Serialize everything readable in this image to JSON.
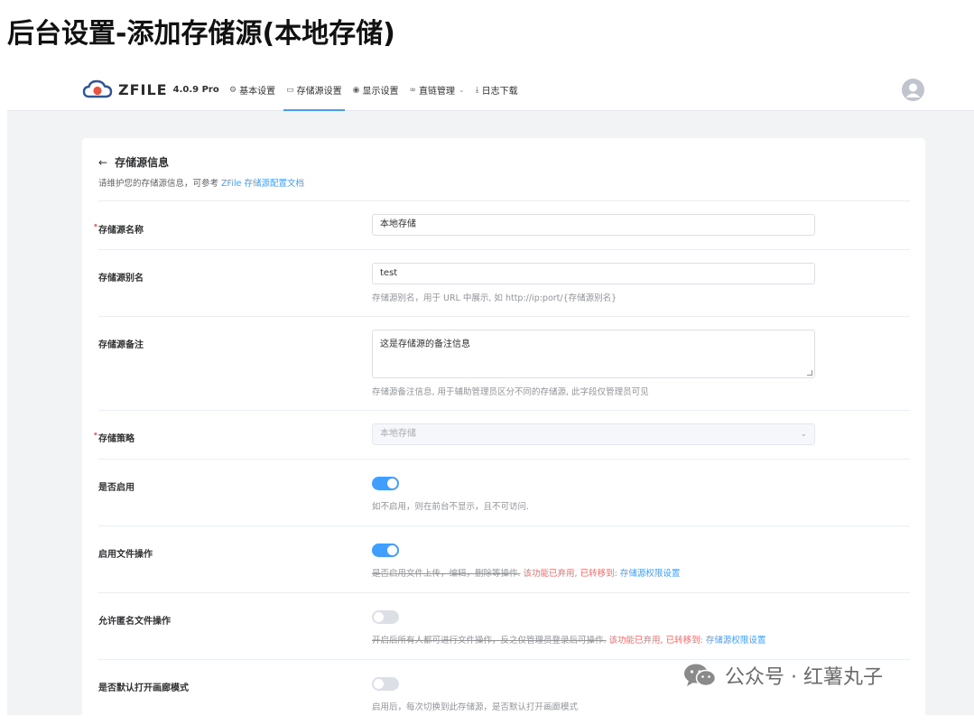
{
  "page_heading": "后台设置-添加存储源(本地存储)",
  "app": {
    "logo_name": "ZFILE",
    "version": "4.0.9 Pro",
    "nav": [
      {
        "label": "基本设置",
        "icon": "gear-icon",
        "glyph": "⚙"
      },
      {
        "label": "存储源设置",
        "icon": "folder-icon",
        "glyph": "▭",
        "active": true
      },
      {
        "label": "显示设置",
        "icon": "eye-icon",
        "glyph": "◉"
      },
      {
        "label": "直链管理",
        "icon": "link-icon",
        "glyph": "∞",
        "has_dropdown": true
      },
      {
        "label": "日志下载",
        "icon": "download-icon",
        "glyph": "⤓"
      }
    ],
    "accent": "#409eff"
  },
  "card": {
    "title": "存储源信息",
    "subtitle_prefix": "请维护您的存储源信息，可参考 ",
    "subtitle_link": "ZFile 存储源配置文档"
  },
  "form": {
    "name": {
      "label": "存储源名称",
      "required": true,
      "value": "本地存储"
    },
    "alias": {
      "label": "存储源别名",
      "value": "test",
      "hint": "存储源别名，用于 URL 中展示, 如 http://ip:port/{存储源别名}"
    },
    "remark": {
      "label": "存储源备注",
      "value": "这是存储源的备注信息",
      "hint": "存储源备注信息, 用于辅助管理员区分不同的存储源, 此字段仅管理员可见"
    },
    "strategy": {
      "label": "存储策略",
      "required": true,
      "value": "本地存储"
    },
    "enabled": {
      "label": "是否启用",
      "on": true,
      "hint": "如不启用，则在前台不显示，且不可访问."
    },
    "file_ops": {
      "label": "启用文件操作",
      "on": true,
      "hint_strike": "是否启用文件上传，编辑，删除等操作.",
      "hint_warn": " 该功能已弃用, 已转移到: ",
      "hint_link": "存储源权限设置"
    },
    "anon_ops": {
      "label": "允许匿名文件操作",
      "on": false,
      "hint_strike": "开启后所有人都可进行文件操作，反之仅管理员登录后可操作.",
      "hint_warn": " 该功能已弃用, 已转移到: ",
      "hint_link": "存储源权限设置"
    },
    "gallery": {
      "label": "是否默认打开画廊模式",
      "on": false,
      "hint": "启用后，每次切换到此存储源，是否默认打开画廊模式"
    }
  },
  "watermark": "公众号 · 红薯丸子"
}
